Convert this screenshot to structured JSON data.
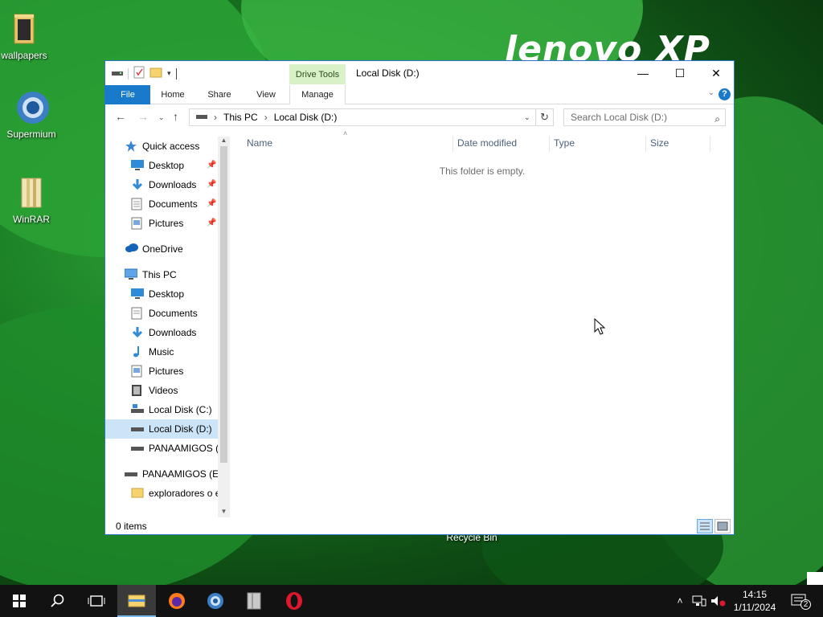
{
  "desktop": {
    "brand": "lenovo XP",
    "icons": [
      {
        "label": "wallpapers",
        "icon": "folder-icon"
      },
      {
        "label": "Supermium",
        "icon": "supermium-icon"
      },
      {
        "label": "WinRAR",
        "icon": "winrar-icon"
      }
    ],
    "recycle_label": "Recycle Bin"
  },
  "window": {
    "context_tab": "Drive Tools",
    "title": "Local Disk (D:)",
    "controls": {
      "minimize": "—",
      "maximize": "☐",
      "close": "✕"
    },
    "ribbon_tabs": [
      "File",
      "Home",
      "Share",
      "View",
      "Manage"
    ],
    "help": "?",
    "address": {
      "segments": [
        "This PC",
        "Local Disk (D:)"
      ],
      "separator": "›"
    },
    "search": {
      "placeholder": "Search Local Disk (D:)"
    },
    "nav": [
      {
        "label": "Quick access",
        "icon": "star-icon",
        "indent": 0
      },
      {
        "label": "Desktop",
        "icon": "desktop-icon",
        "indent": 1,
        "pinned": true
      },
      {
        "label": "Downloads",
        "icon": "download-icon",
        "indent": 1,
        "pinned": true
      },
      {
        "label": "Documents",
        "icon": "document-icon",
        "indent": 1,
        "pinned": true
      },
      {
        "label": "Pictures",
        "icon": "picture-icon",
        "indent": 1,
        "pinned": true
      },
      {
        "label": "OneDrive",
        "icon": "cloud-icon",
        "indent": 0
      },
      {
        "label": "This PC",
        "icon": "computer-icon",
        "indent": 0
      },
      {
        "label": "Desktop",
        "icon": "desktop-icon",
        "indent": 1
      },
      {
        "label": "Documents",
        "icon": "document-icon",
        "indent": 1
      },
      {
        "label": "Downloads",
        "icon": "download-icon",
        "indent": 1
      },
      {
        "label": "Music",
        "icon": "music-icon",
        "indent": 1
      },
      {
        "label": "Pictures",
        "icon": "picture-icon",
        "indent": 1
      },
      {
        "label": "Videos",
        "icon": "video-icon",
        "indent": 1
      },
      {
        "label": "Local Disk (C:)",
        "icon": "drive-icon",
        "indent": 1
      },
      {
        "label": "Local Disk (D:)",
        "icon": "drive-icon",
        "indent": 1,
        "selected": true
      },
      {
        "label": "PANAAMIGOS (E",
        "icon": "drive-icon",
        "indent": 1
      },
      {
        "label": "PANAAMIGOS (E:)",
        "icon": "drive-icon",
        "indent": 0
      },
      {
        "label": "exploradores o e",
        "icon": "folder-icon",
        "indent": 1
      }
    ],
    "columns": [
      "Name",
      "Date modified",
      "Type",
      "Size"
    ],
    "empty_message": "This folder is empty.",
    "status": "0 items"
  },
  "taskbar": {
    "apps": [
      "start-icon",
      "search-icon",
      "task-view-icon",
      "file-explorer-icon",
      "firefox-icon",
      "supermium-icon",
      "winrar-icon",
      "opera-icon"
    ],
    "time": "14:15",
    "date": "1/11/2024",
    "notifications": "2"
  }
}
